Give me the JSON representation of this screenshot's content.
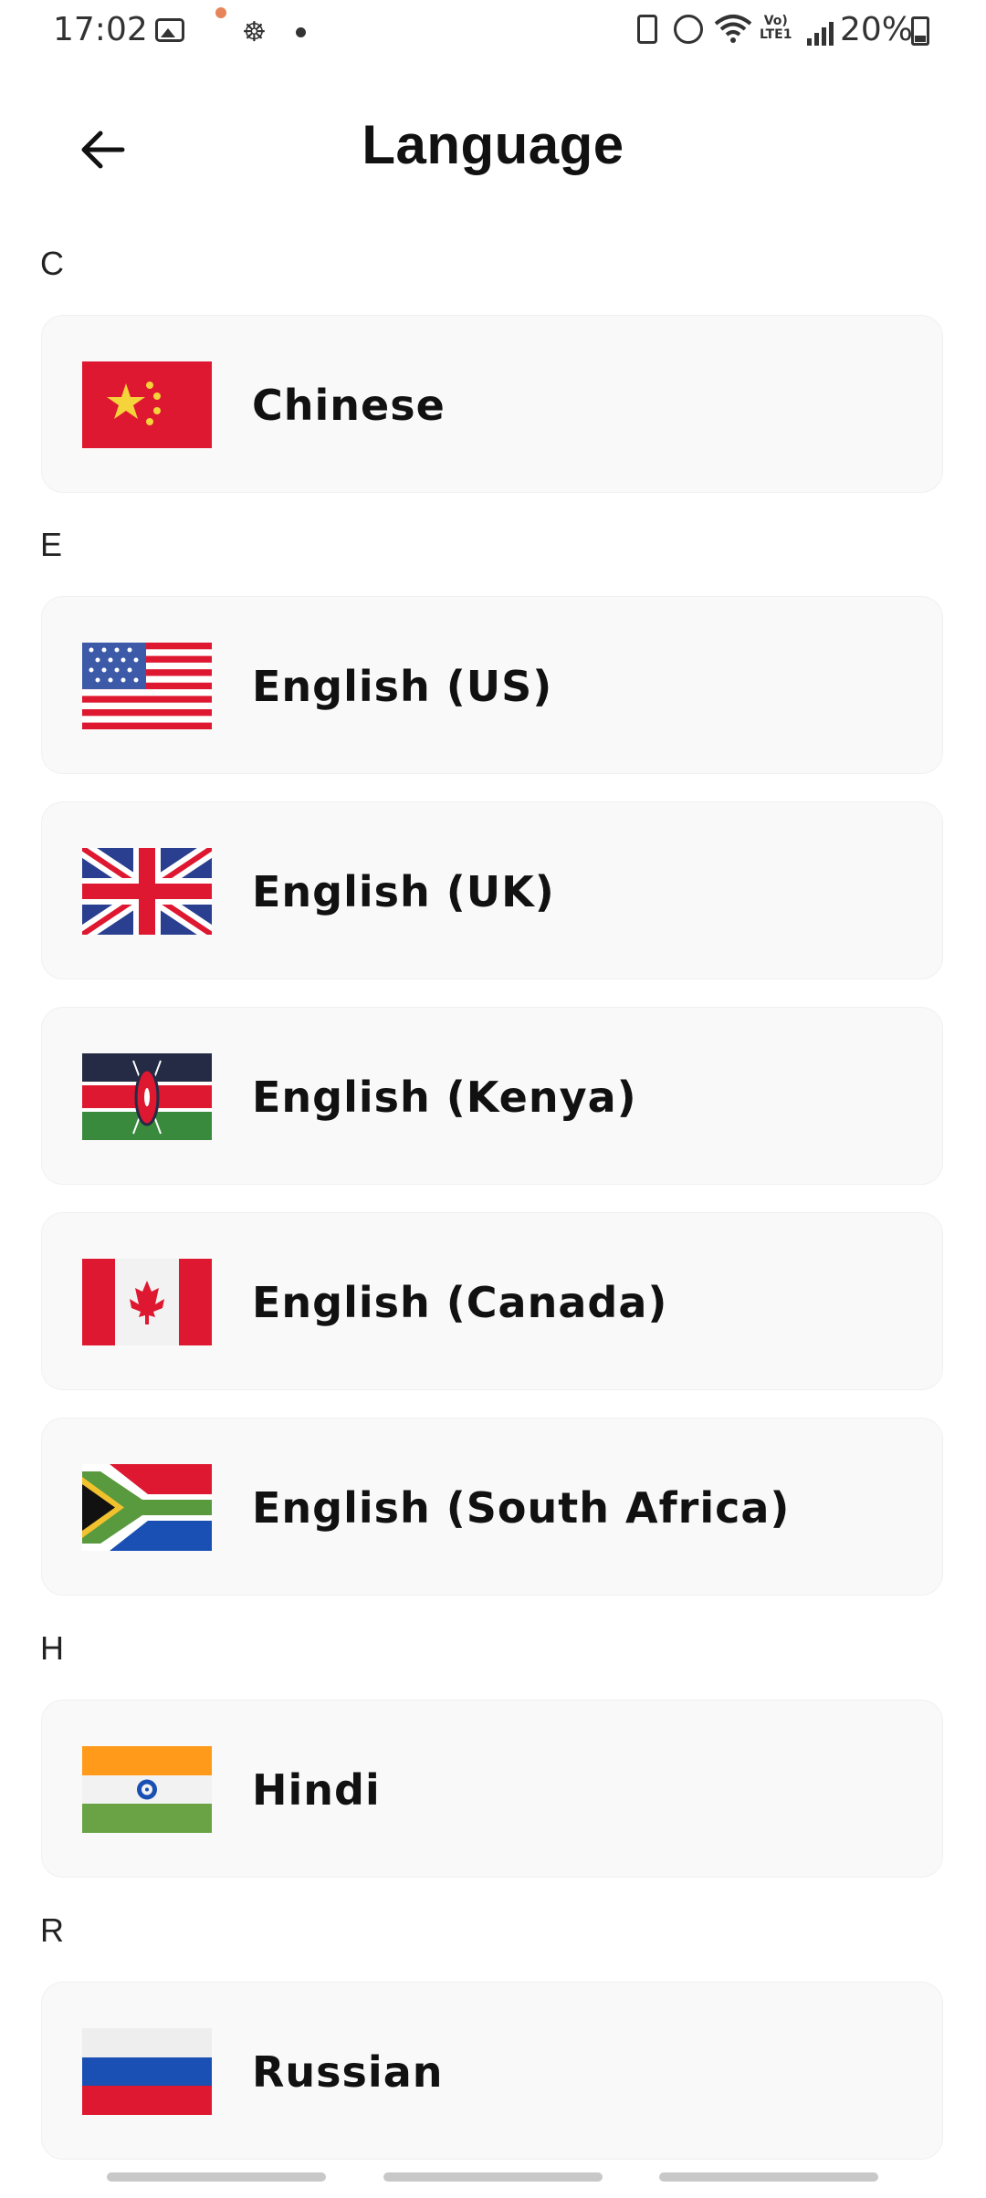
{
  "status_bar": {
    "time": "17:02",
    "volte_line1": "Vo)",
    "volte_line2": "LTE1",
    "battery": "20%"
  },
  "header": {
    "title": "Language"
  },
  "sections": [
    {
      "letter": "C",
      "items": [
        {
          "label": "Chinese",
          "flag": "china-flag"
        }
      ]
    },
    {
      "letter": "E",
      "items": [
        {
          "label": "English (US)",
          "flag": "usa-flag"
        },
        {
          "label": "English (UK)",
          "flag": "uk-flag"
        },
        {
          "label": "English (Kenya)",
          "flag": "kenya-flag"
        },
        {
          "label": "English (Canada)",
          "flag": "canada-flag"
        },
        {
          "label": "English (South Africa)",
          "flag": "south-africa-flag"
        }
      ]
    },
    {
      "letter": "H",
      "items": [
        {
          "label": "Hindi",
          "flag": "india-flag"
        }
      ]
    },
    {
      "letter": "R",
      "items": [
        {
          "label": "Russian",
          "flag": "russia-flag"
        }
      ]
    }
  ],
  "colors": {
    "card_bg": "#f9f9f9",
    "accent_red": "#de1830"
  }
}
